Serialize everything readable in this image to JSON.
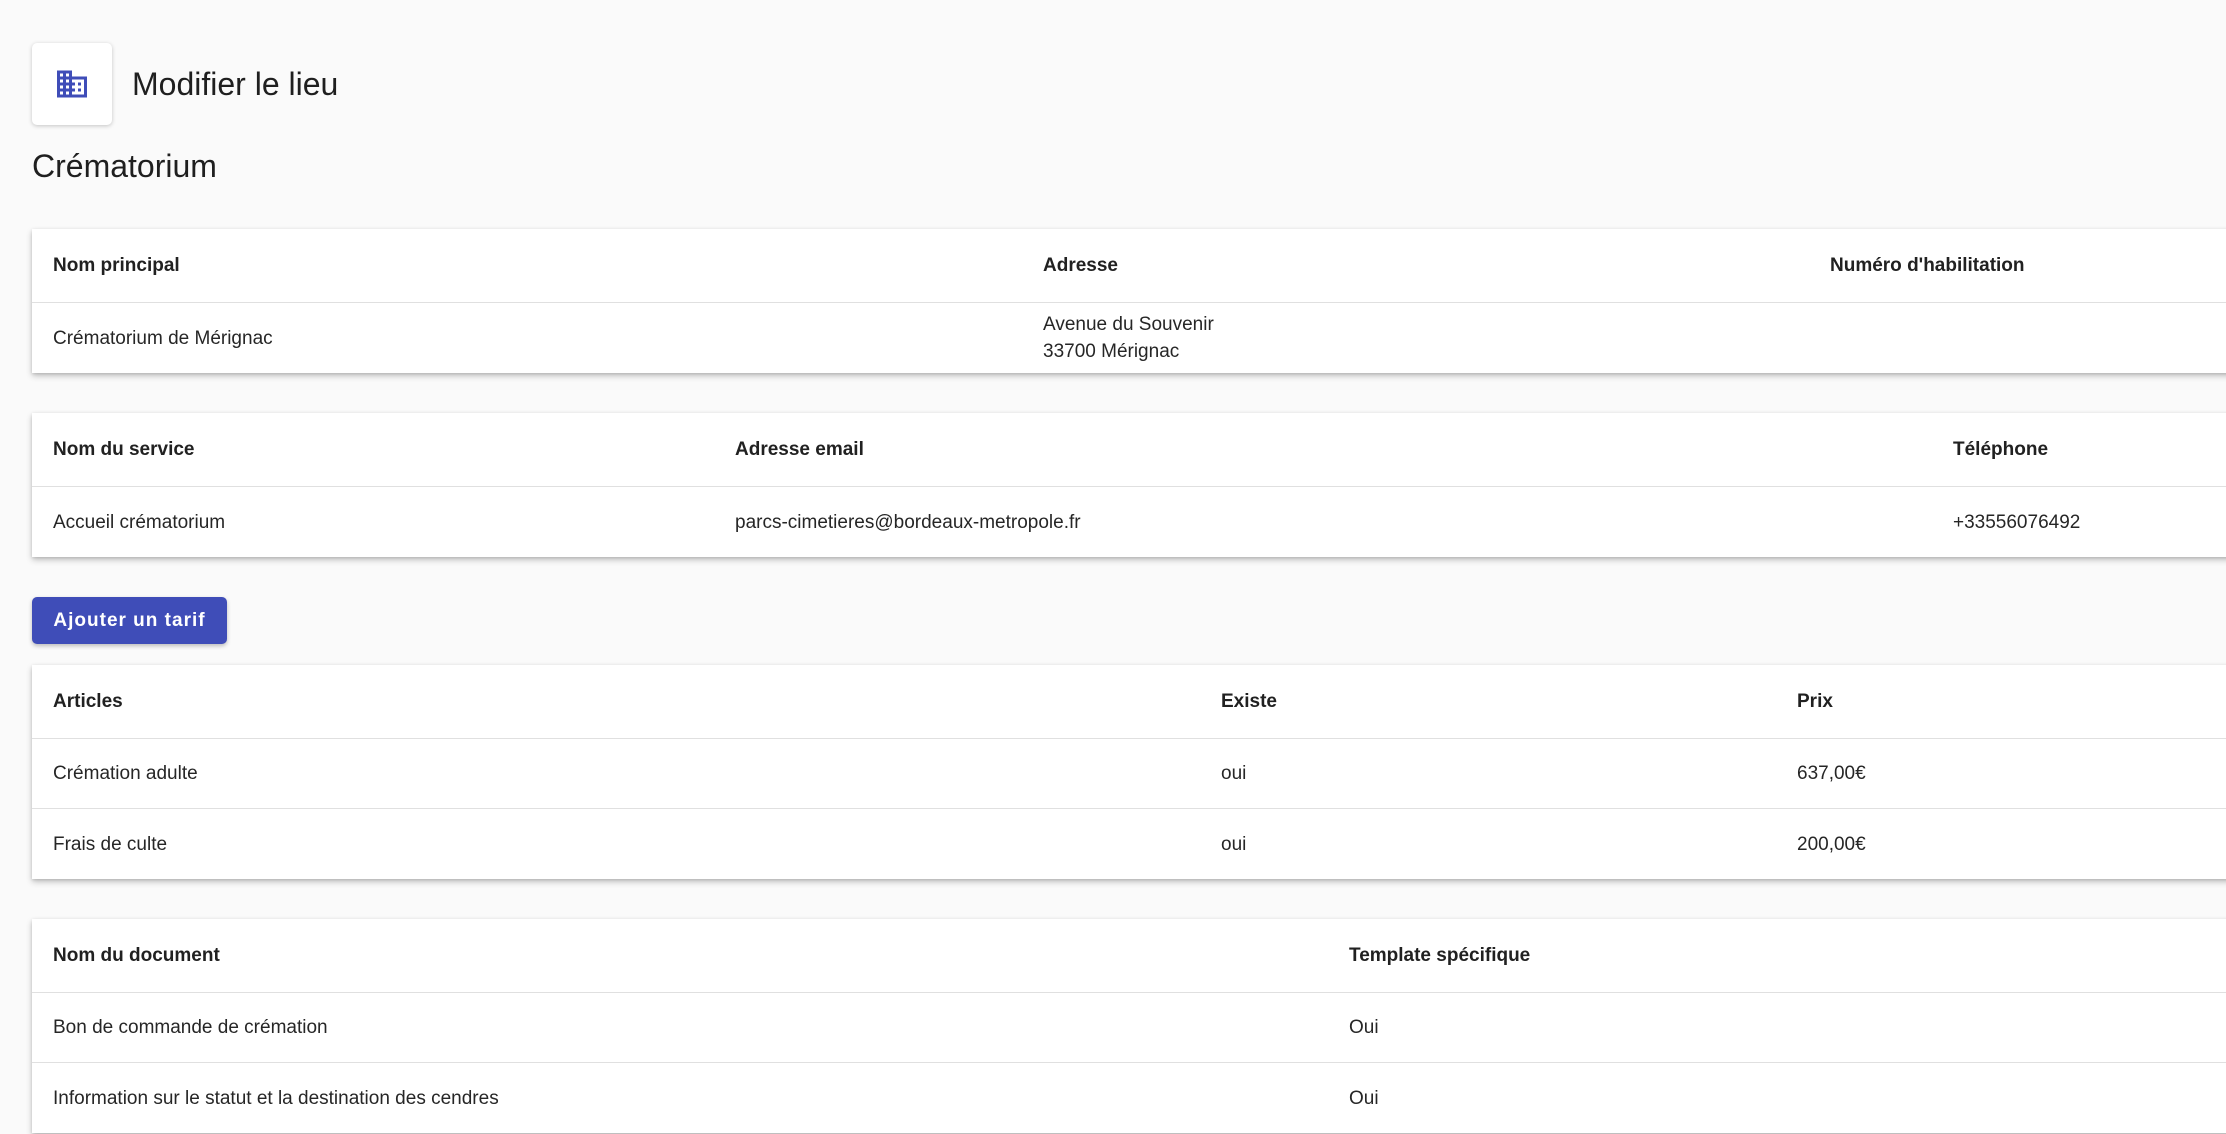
{
  "header": {
    "title": "Modifier le lieu",
    "icon": "building-icon",
    "accent_color": "#3f4db8"
  },
  "section_title": "Crématorium",
  "place_table": {
    "columns": [
      "Nom principal",
      "Adresse",
      "Numéro d'habilitation"
    ],
    "row": {
      "name": "Crématorium de Mérignac",
      "address_line1": "Avenue du Souvenir",
      "address_line2": "33700 Mérignac",
      "license_number": ""
    }
  },
  "service_table": {
    "columns": [
      "Nom du service",
      "Adresse email",
      "Téléphone"
    ],
    "row": {
      "service_name": "Accueil crématorium",
      "email": "parcs-cimetieres@bordeaux-metropole.fr",
      "phone": "+33556076492"
    }
  },
  "add_tariff_button": "Ajouter un tarif",
  "tariff_table": {
    "columns": [
      "Articles",
      "Existe",
      "Prix"
    ],
    "rows": [
      {
        "article": "Crémation adulte",
        "exists": "oui",
        "price": "637,00€"
      },
      {
        "article": "Frais de culte",
        "exists": "oui",
        "price": "200,00€"
      }
    ]
  },
  "documents_table": {
    "columns": [
      "Nom du document",
      "Template spécifique"
    ],
    "rows": [
      {
        "name": "Bon de commande de crémation",
        "specific_template": "Oui"
      },
      {
        "name": "Information sur le statut et la destination des cendres",
        "specific_template": "Oui"
      }
    ]
  }
}
